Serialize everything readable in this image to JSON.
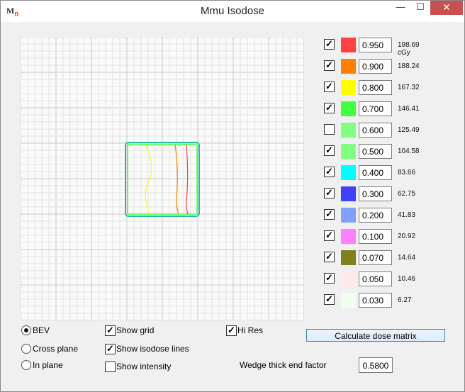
{
  "window": {
    "title": "Mmu Isodose",
    "icon_text": "M",
    "icon_sub": "D",
    "min_glyph": "—",
    "max_glyph": "☐",
    "close_glyph": "✕"
  },
  "isodose_levels": [
    {
      "checked": true,
      "color": "#ff4040",
      "value": "0.950",
      "dose": "198.69 cGy"
    },
    {
      "checked": true,
      "color": "#ff8000",
      "value": "0.900",
      "dose": "188.24"
    },
    {
      "checked": true,
      "color": "#ffff00",
      "value": "0.800",
      "dose": "167.32"
    },
    {
      "checked": true,
      "color": "#40ff40",
      "value": "0.700",
      "dose": "146.41"
    },
    {
      "checked": false,
      "color": "#80ff80",
      "value": "0.600",
      "dose": "125.49"
    },
    {
      "checked": true,
      "color": "#80ff80",
      "value": "0.500",
      "dose": "104.58"
    },
    {
      "checked": true,
      "color": "#00ffff",
      "value": "0.400",
      "dose": "83.66"
    },
    {
      "checked": true,
      "color": "#4040ff",
      "value": "0.300",
      "dose": "62.75"
    },
    {
      "checked": true,
      "color": "#80a0ff",
      "value": "0.200",
      "dose": "41.83"
    },
    {
      "checked": true,
      "color": "#ff80ff",
      "value": "0.100",
      "dose": "20.92"
    },
    {
      "checked": true,
      "color": "#808020",
      "value": "0.070",
      "dose": "14.64"
    },
    {
      "checked": true,
      "color": "#ffe8e8",
      "value": "0.050",
      "dose": "10.46"
    },
    {
      "checked": true,
      "color": "#f0fff0",
      "value": "0.030",
      "dose": "6.27"
    }
  ],
  "view_options": [
    {
      "label": "BEV",
      "selected": true
    },
    {
      "label": "Cross plane",
      "selected": false
    },
    {
      "label": "In plane",
      "selected": false
    }
  ],
  "display_options": [
    {
      "label": "Show grid",
      "checked": true
    },
    {
      "label": "Show isodose lines",
      "checked": true
    },
    {
      "label": "Show intensity",
      "checked": false
    }
  ],
  "hi_res": {
    "label": "Hi Res",
    "checked": true
  },
  "calculate_button": "Calculate dose matrix",
  "wedge": {
    "label": "Wedge thick end factor",
    "value": "0.5800"
  },
  "colors": {
    "accent": "#3c7fb1",
    "field_outline": "#20c0a0"
  }
}
